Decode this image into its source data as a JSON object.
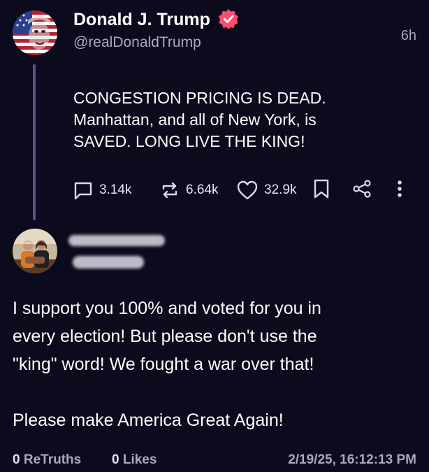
{
  "post": {
    "display_name": "Donald J. Trump",
    "handle": "@realDonaldTrump",
    "time_ago": "6h",
    "body_lines": [
      "CONGESTION PRICING IS DEAD.",
      "Manhattan, and all of New York, is",
      "SAVED. LONG LIVE THE KING!"
    ],
    "replies_count": "3.14k",
    "retruths_count": "6.64k",
    "likes_count": "32.9k",
    "verified_color": "#ff4d6d"
  },
  "reply": {
    "body_lines": [
      "I support you 100% and voted for you in",
      "every election! But please don't use the",
      "\"king\" word! We fought a war over that!",
      "",
      "Please make America Great Again!"
    ],
    "retruths_count": "0",
    "retruths_label": "ReTruths",
    "likes_count": "0",
    "likes_label": "Likes",
    "datetime": "2/19/25, 16:12:13 PM"
  },
  "icons": [
    "verified-badge-icon",
    "reply-icon",
    "retruth-icon",
    "heart-icon",
    "bookmark-icon",
    "share-icon",
    "more-icon"
  ],
  "colors": {
    "background": "#0c0b1d",
    "thread_line": "#5b4f8c",
    "secondary_text": "#aaa7bf"
  }
}
